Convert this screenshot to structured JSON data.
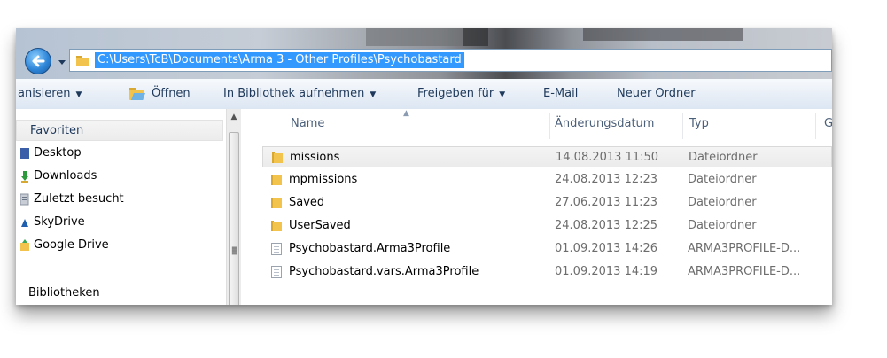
{
  "address": {
    "path": "C:\\Users\\TcB\\Documents\\Arma 3 - Other Profiles\\Psychobastard"
  },
  "toolbar": {
    "organize": "anisieren",
    "open": "Öffnen",
    "include_library": "In Bibliothek aufnehmen",
    "share_with": "Freigeben für",
    "email": "E-Mail",
    "new_folder": "Neuer Ordner"
  },
  "nav": {
    "favorites": "Favoriten",
    "items": [
      {
        "label": "Desktop",
        "icon": "desktop-icon"
      },
      {
        "label": "Downloads",
        "icon": "downloads-icon"
      },
      {
        "label": "Zuletzt besucht",
        "icon": "recent-places-icon"
      },
      {
        "label": "SkyDrive",
        "icon": "skydrive-icon"
      },
      {
        "label": "Google Drive",
        "icon": "google-drive-icon"
      }
    ],
    "libraries": "Bibliotheken"
  },
  "columns": {
    "name": "Name",
    "modified": "Änderungsdatum",
    "type": "Typ",
    "size_partial": "G"
  },
  "files": [
    {
      "name": "missions",
      "modified": "14.08.2013 11:50",
      "type": "Dateiordner",
      "icon": "folder-icon",
      "selected": true
    },
    {
      "name": "mpmissions",
      "modified": "24.08.2013 12:23",
      "type": "Dateiordner",
      "icon": "folder-icon"
    },
    {
      "name": "Saved",
      "modified": "27.06.2013 11:23",
      "type": "Dateiordner",
      "icon": "folder-icon"
    },
    {
      "name": "UserSaved",
      "modified": "24.08.2013 12:25",
      "type": "Dateiordner",
      "icon": "folder-icon"
    },
    {
      "name": "Psychobastard.Arma3Profile",
      "modified": "01.09.2013 14:26",
      "type": "ARMA3PROFILE-D...",
      "icon": "file-icon"
    },
    {
      "name": "Psychobastard.vars.Arma3Profile",
      "modified": "01.09.2013 14:19",
      "type": "ARMA3PROFILE-D...",
      "icon": "file-icon"
    }
  ],
  "colors": {
    "selection": "#3399ff",
    "toolbar_text": "#1e395b",
    "secondary_text": "#6d6d6d",
    "folder_yellow": "#f2c44d"
  }
}
